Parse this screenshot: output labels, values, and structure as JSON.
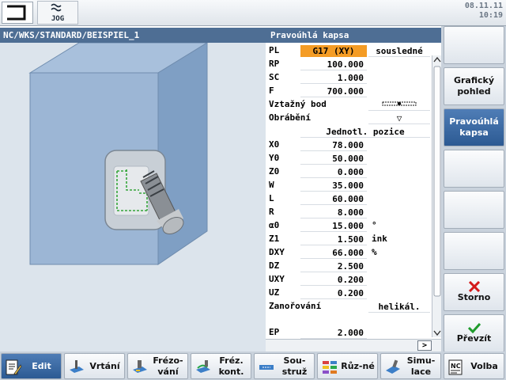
{
  "topbar": {
    "mode_label": "JOG",
    "date": "08.11.11",
    "time": "10:19"
  },
  "left_pane": {
    "path": "NC/WKS/STANDARD/BEISPIEL_1"
  },
  "form": {
    "title": "Pravoúhlá kapsa",
    "rows": [
      {
        "name": "PL",
        "value": "G17 (XY)",
        "toggle": "sousledné"
      },
      {
        "name": "RP",
        "value": "100.000"
      },
      {
        "name": "SC",
        "value": "1.000"
      },
      {
        "name": "F",
        "value": "700.000"
      },
      {
        "name": "Vztažný bod"
      },
      {
        "name": "Obrábění",
        "toggle": "▽"
      },
      {
        "value": "Jednotl. pozice"
      },
      {
        "name": "X0",
        "value": "78.000"
      },
      {
        "name": "Y0",
        "value": "50.000"
      },
      {
        "name": "Z0",
        "value": "0.000"
      },
      {
        "name": "W",
        "value": "35.000"
      },
      {
        "name": "L",
        "value": "60.000"
      },
      {
        "name": "R",
        "value": "8.000"
      },
      {
        "name": "α0",
        "value": "15.000",
        "unit": "°"
      },
      {
        "name": "Z1",
        "value": "1.500",
        "unit": "ink"
      },
      {
        "name": "DXY",
        "value": "66.000",
        "unit": "%"
      },
      {
        "name": "DZ",
        "value": "2.500"
      },
      {
        "name": "UXY",
        "value": "0.200"
      },
      {
        "name": "UZ",
        "value": "0.200"
      },
      {
        "name": "Zanořování",
        "toggle": "helikál."
      },
      {},
      {
        "name": "EP",
        "value": "2.000"
      }
    ],
    "hscroll_arrow": ">"
  },
  "vertical_softkeys": [
    {
      "label": ""
    },
    {
      "label": "Grafický pohled"
    },
    {
      "label": "Pravoúhlá kapsa",
      "active": true
    },
    {
      "label": ""
    },
    {
      "label": ""
    },
    {
      "label": ""
    },
    {
      "label": "Storno",
      "icon": "cancel-x-icon",
      "icon_color": "#d41a1a"
    },
    {
      "label": "Převzít",
      "icon": "checkmark-icon",
      "icon_color": "#1f9b2c"
    }
  ],
  "horizontal_softkeys": [
    {
      "label": "Edit",
      "icon": "edit-icon",
      "active": true
    },
    {
      "label": "Vrtání",
      "icon": "drilling-icon"
    },
    {
      "label": "Frézo-vání",
      "icon": "milling-icon"
    },
    {
      "label": "Fréz. kont.",
      "icon": "contour-milling-icon"
    },
    {
      "label": "Sou-struž",
      "icon": "turning-icon"
    },
    {
      "label": "Růz-né",
      "icon": "various-icon"
    },
    {
      "label": "Simu-lace",
      "icon": "simulation-icon"
    },
    {
      "label": "Volba",
      "icon": "nc-select-icon"
    }
  ]
}
